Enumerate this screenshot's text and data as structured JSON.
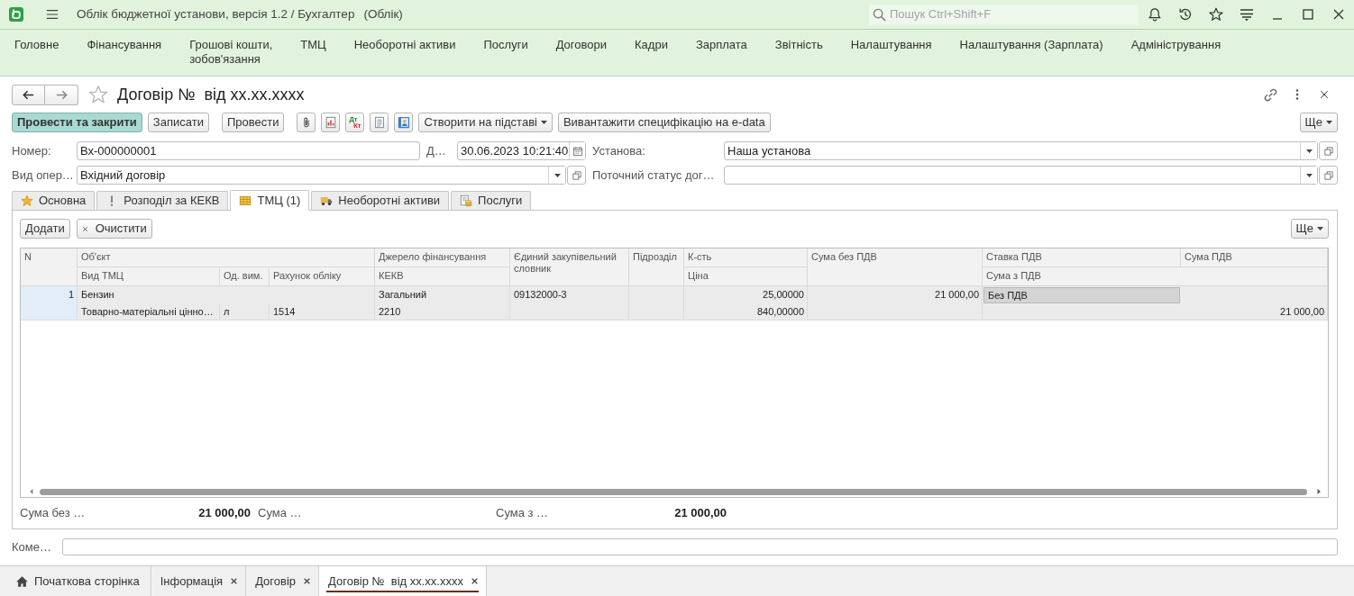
{
  "window": {
    "title": "Облік бюджетної установи, версія 1.2 / Бухгалтер",
    "context": "(Облік)"
  },
  "search": {
    "placeholder": "Пошук Ctrl+Shift+F"
  },
  "menu": [
    "Головне",
    "Фінансування",
    "Грошові кошти,\nзобов'язання",
    "ТМЦ",
    "Необоротні активи",
    "Послуги",
    "Договори",
    "Кадри",
    "Зарплата",
    "Звітність",
    "Налаштування",
    "Налаштування (Зарплата)",
    "Адміністрування"
  ],
  "form": {
    "title": "Договір №  від xx.xx.xxxx",
    "favorite": false
  },
  "toolbar": [
    {
      "kind": "default",
      "label": "Провести та закрити"
    },
    {
      "kind": "button",
      "label": "Записати"
    },
    {
      "kind": "button",
      "label": "Провести"
    },
    {
      "kind": "icon"
    },
    {
      "kind": "icon"
    },
    {
      "kind": "ledger",
      "debit": "Дт",
      "credit": "Кт"
    },
    {
      "kind": "icon"
    },
    {
      "kind": "icon"
    },
    {
      "kind": "menu",
      "label": "Створити на підставі"
    },
    {
      "kind": "button",
      "label": "Вивантажити специфікацію на e-data"
    }
  ],
  "toolbar_more": {
    "label": "Ще"
  },
  "field_rows": [
    [
      {
        "kind": "text",
        "label": "Номер:",
        "value": "Вх-000000001"
      },
      {
        "kind": "date",
        "label": "Д…",
        "value": "30.06.2023 10:21:40"
      },
      {
        "kind": "select",
        "label": "Установа:",
        "value": "Наша установа"
      }
    ],
    [
      {
        "kind": "select",
        "label": "Вид опер…",
        "value": "Вхідний договір"
      },
      {
        "kind": "select",
        "label": "Поточний статус дог…"
      }
    ]
  ],
  "tabs": [
    {
      "label": "Основна",
      "selected": false
    },
    {
      "label": "Розподіл за КЕКВ",
      "selected": false
    },
    {
      "label": "ТМЦ (1)",
      "selected": true
    },
    {
      "label": "Необоротні активи",
      "selected": false
    },
    {
      "label": "Послуги",
      "selected": false
    }
  ],
  "tab_toolbar": {
    "buttons": [
      {
        "kind": "button",
        "label": "Додати"
      },
      {
        "kind": "clear",
        "label": "Очистити"
      }
    ],
    "more": "Ще"
  },
  "table": {
    "header": [
      "N",
      "Об'єкт",
      "Джерело фінансування",
      "Єдиний закупівельний словник",
      "Підрозділ",
      "К-сть",
      "Сума без ПДВ",
      "Ставка ПДВ",
      "Сума ПДВ",
      "Вид ТМЦ",
      "Од. вим.",
      "Рахунок обліку",
      "КЕКВ",
      "Ціна",
      "Сума з ПДВ"
    ],
    "rows": [
      {
        "selected": true,
        "n": "1",
        "object": "Бензин",
        "source": "Загальний",
        "dictionary": "09132000-3",
        "quantity": "25,00000",
        "sum_without_vat": "21 000,00",
        "vat_rate": "Без ПДВ",
        "vat_rate_focused": true,
        "item_type": "Товарно-матеріальні цінно…",
        "unit": "л",
        "account": "1514",
        "kekv": "2210",
        "price": "840,00000",
        "sum_with_vat": "21 000,00"
      }
    ]
  },
  "totals": [
    {
      "label": "Сума без …",
      "value": "21 000,00"
    },
    {
      "label": "Сума …"
    },
    {
      "label": "Сума з …",
      "value": "21 000,00"
    }
  ],
  "comment": {
    "label": "Коме…"
  },
  "open_windows": [
    {
      "kind": "home",
      "label": "Початкова сторінка",
      "selected": false
    },
    {
      "kind": "window",
      "label": "Інформація",
      "selected": false
    },
    {
      "kind": "window",
      "label": "Договір",
      "selected": false
    },
    {
      "kind": "window",
      "label": "Договір №  від xx.xx.xxxx",
      "selected": true
    }
  ]
}
